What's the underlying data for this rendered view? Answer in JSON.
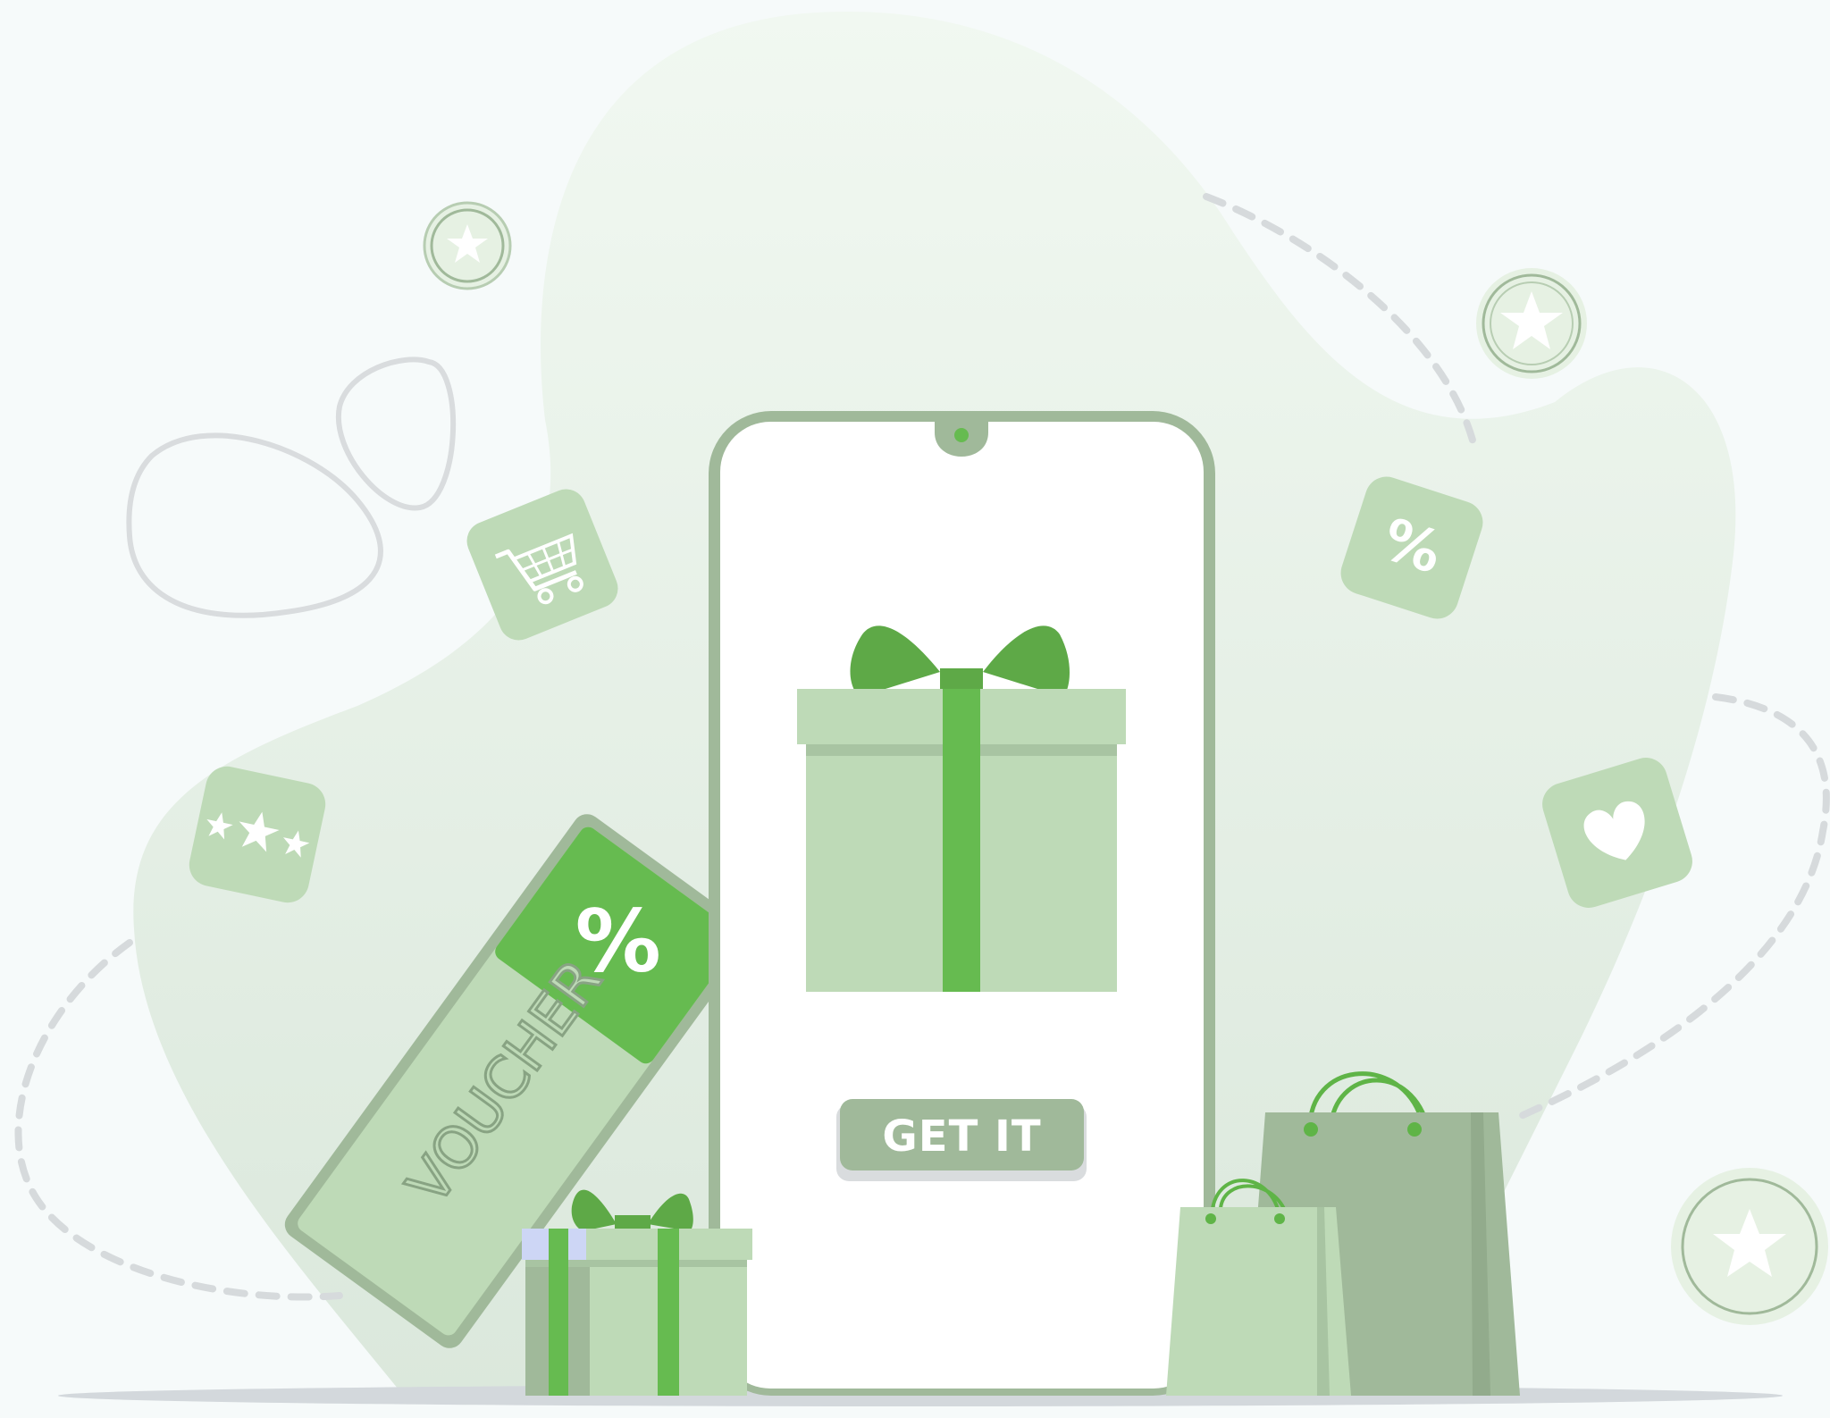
{
  "cta": {
    "label": "GET IT"
  },
  "voucher": {
    "label": "VOUCHER",
    "percent_symbol": "%"
  },
  "discount_tile": {
    "symbol": "%"
  },
  "colors": {
    "background": "#f6fafa",
    "blob": "#e3efe3",
    "pale_green": "#bedab7",
    "muted_green": "#a0b99a",
    "bright_green": "#66bb50",
    "dark_green": "#5ea947",
    "dashed_line": "#d6dadc",
    "floor_shadow": "#d3d8dc"
  },
  "icons": [
    "shopping-cart-icon",
    "percent-icon",
    "rating-stars-icon",
    "heart-icon",
    "star-coin-icon",
    "gift-box-icon",
    "shopping-bag-icon"
  ]
}
